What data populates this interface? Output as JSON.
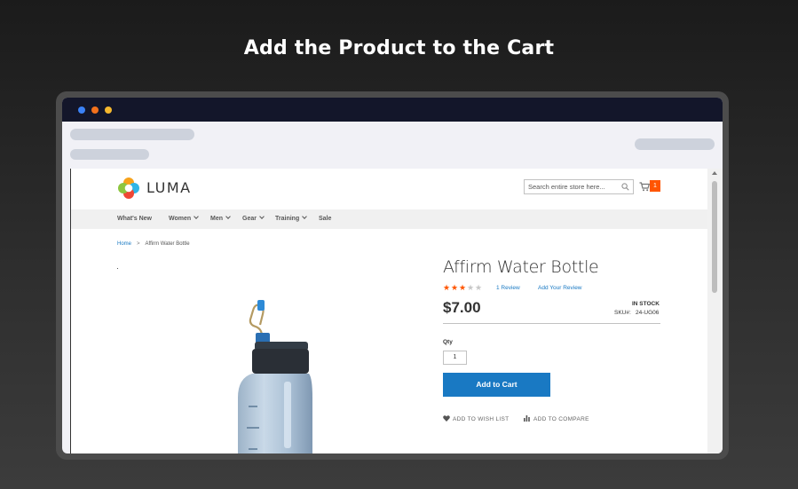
{
  "headline": "Add the Product to the Cart",
  "browser": {
    "traffic_lights": [
      "blue",
      "orange",
      "yellow"
    ]
  },
  "store": {
    "logo_text": "LUMA",
    "search_placeholder": "Search entire store here...",
    "cart_count": "1",
    "nav": [
      {
        "label": "What's New",
        "has_dropdown": false
      },
      {
        "label": "Women",
        "has_dropdown": true
      },
      {
        "label": "Men",
        "has_dropdown": true
      },
      {
        "label": "Gear",
        "has_dropdown": true
      },
      {
        "label": "Training",
        "has_dropdown": true
      },
      {
        "label": "Sale",
        "has_dropdown": false
      }
    ]
  },
  "breadcrumb": {
    "home": "Home",
    "separator": ">",
    "current": "Affirm Water Bottle"
  },
  "product": {
    "title": "Affirm Water Bottle",
    "rating": 3,
    "rating_max": 5,
    "review_count": "1  Review",
    "add_review": "Add Your Review",
    "price": "$7.00",
    "stock": "IN STOCK",
    "sku_label": "SKU#:",
    "sku_value": "24-UG06",
    "qty_label": "Qty",
    "qty_value": "1",
    "add_to_cart": "Add to Cart",
    "wish_list": "ADD TO WISH LIST",
    "compare": "ADD TO COMPARE"
  },
  "colors": {
    "accent_blue": "#1979c3",
    "cart_badge": "#ff5501",
    "star_filled": "#ff5501",
    "star_empty": "#c7c7c7"
  }
}
